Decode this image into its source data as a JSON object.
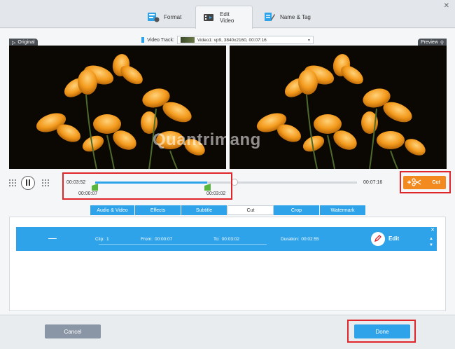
{
  "header": {
    "tabs": [
      {
        "label": "Format",
        "icon": "format-icon"
      },
      {
        "label": "Edit Video",
        "icon": "edit-video-icon"
      },
      {
        "label": "Name & Tag",
        "icon": "name-tag-icon"
      }
    ],
    "active_tab": "Edit Video",
    "close_glyph": "✕"
  },
  "video_track": {
    "label": "Video Track:",
    "value": "Video1: vp9, 3840x2160, 00:07:16"
  },
  "panes": {
    "original_label": "Original",
    "preview_label": "Preview"
  },
  "watermark": "Quantrimang",
  "playback": {
    "current_time": "00:03:52",
    "duration": "00:07:16",
    "clip_start": "00:00:07",
    "clip_end": "00:03:02",
    "cut_label": "Cut",
    "progress": 0.53
  },
  "edit_tabs": [
    {
      "label": "Audio & Video",
      "active": false
    },
    {
      "label": "Effects",
      "active": false
    },
    {
      "label": "Subtitle",
      "active": false
    },
    {
      "label": "Cut",
      "active": true
    },
    {
      "label": "Crop",
      "active": false
    },
    {
      "label": "Watermark",
      "active": false
    }
  ],
  "clip": {
    "clip_label": "Clip:",
    "clip_value": "1",
    "from_label": "From:",
    "from_value": "00:00:07",
    "to_label": "To:",
    "to_value": "00:03:02",
    "duration_label": "Duration:",
    "duration_value": "00:02:55",
    "edit_label": "Edit"
  },
  "footer": {
    "cancel_label": "Cancel",
    "done_label": "Done"
  },
  "colors": {
    "accent_blue": "#2fa3ea",
    "cut_orange": "#f38a1f",
    "highlight_red": "#e0252b"
  }
}
